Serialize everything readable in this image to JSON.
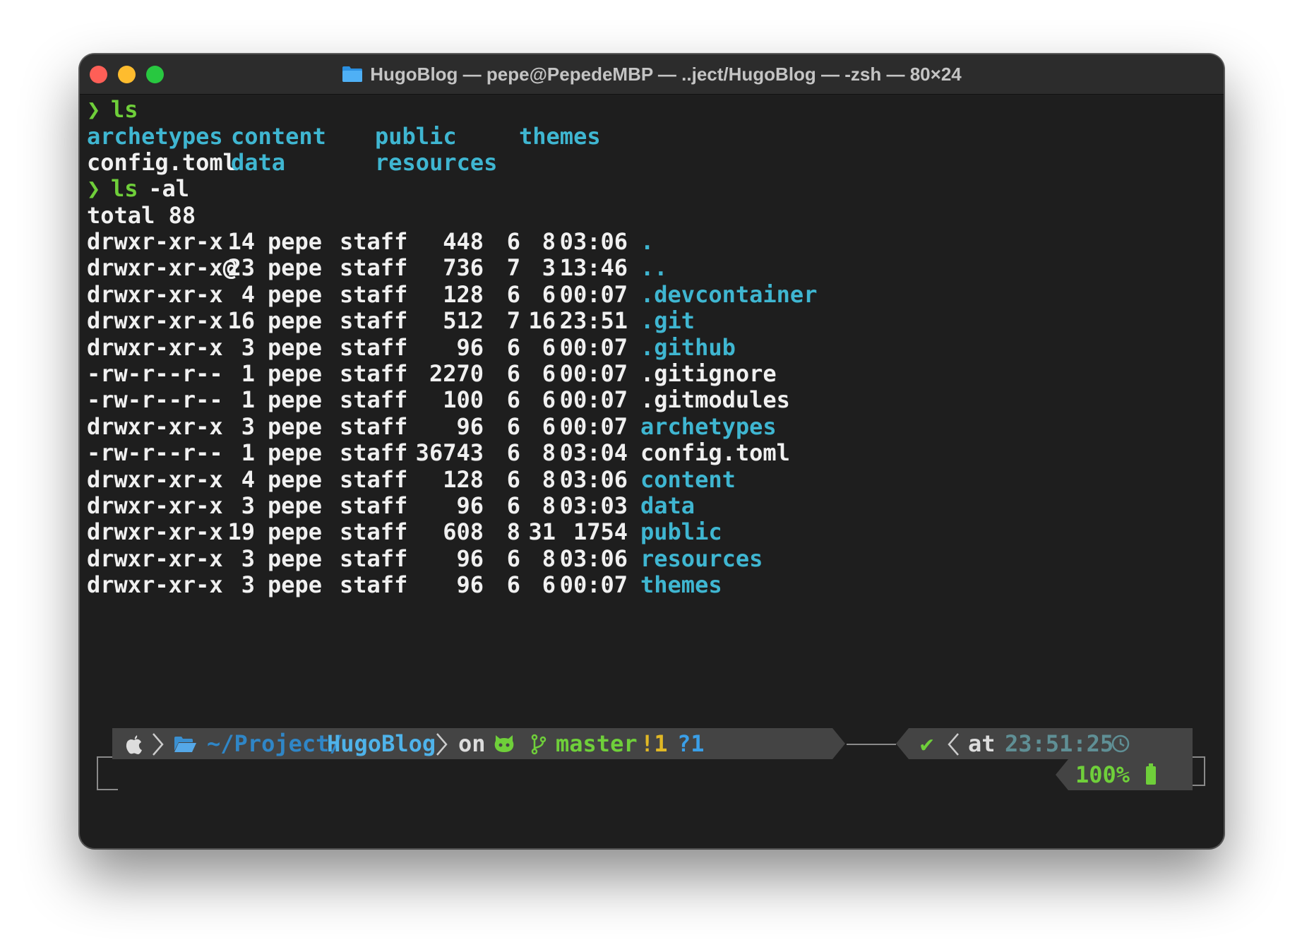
{
  "window": {
    "title": "HugoBlog — pepe@PepedeMBP — ..ject/HugoBlog — -zsh — 80×24",
    "icons": {
      "close": "close-traffic-light",
      "minimize": "minimize-traffic-light",
      "maximize": "maximize-traffic-light",
      "folder": "folder-icon"
    }
  },
  "colors": {
    "directory": "#3fb6d1",
    "prompt": "#6fcf3a",
    "text": "#f0f0f0",
    "background": "#1e1e1e"
  },
  "commands": [
    {
      "prompt": "❯",
      "cmd": "ls",
      "args": ""
    },
    {
      "prompt": "❯",
      "cmd": "ls",
      "args": " -al"
    }
  ],
  "ls_output": [
    [
      "archetypes",
      "content",
      "public",
      "themes"
    ],
    [
      "config.toml",
      "data",
      "resources",
      ""
    ]
  ],
  "total": "total 88",
  "listing": [
    {
      "perm": "drwxr-xr-x",
      "links": "14",
      "user": "pepe",
      "group": "staff",
      "size": "448",
      "month": "6",
      "day": "8",
      "time": "03:06",
      "name": ".",
      "dir": true
    },
    {
      "perm": "drwxr-xr-x@",
      "links": "23",
      "user": "pepe",
      "group": "staff",
      "size": "736",
      "month": "7",
      "day": "3",
      "time": "13:46",
      "name": "..",
      "dir": true
    },
    {
      "perm": "drwxr-xr-x",
      "links": "4",
      "user": "pepe",
      "group": "staff",
      "size": "128",
      "month": "6",
      "day": "6",
      "time": "00:07",
      "name": ".devcontainer",
      "dir": true
    },
    {
      "perm": "drwxr-xr-x",
      "links": "16",
      "user": "pepe",
      "group": "staff",
      "size": "512",
      "month": "7",
      "day": "16",
      "time": "23:51",
      "name": ".git",
      "dir": true
    },
    {
      "perm": "drwxr-xr-x",
      "links": "3",
      "user": "pepe",
      "group": "staff",
      "size": "96",
      "month": "6",
      "day": "6",
      "time": "00:07",
      "name": ".github",
      "dir": true
    },
    {
      "perm": "-rw-r--r--",
      "links": "1",
      "user": "pepe",
      "group": "staff",
      "size": "2270",
      "month": "6",
      "day": "6",
      "time": "00:07",
      "name": ".gitignore",
      "dir": false
    },
    {
      "perm": "-rw-r--r--",
      "links": "1",
      "user": "pepe",
      "group": "staff",
      "size": "100",
      "month": "6",
      "day": "6",
      "time": "00:07",
      "name": ".gitmodules",
      "dir": false
    },
    {
      "perm": "drwxr-xr-x",
      "links": "3",
      "user": "pepe",
      "group": "staff",
      "size": "96",
      "month": "6",
      "day": "6",
      "time": "00:07",
      "name": "archetypes",
      "dir": true
    },
    {
      "perm": "-rw-r--r--",
      "links": "1",
      "user": "pepe",
      "group": "staff",
      "size": "36743",
      "month": "6",
      "day": "8",
      "time": "03:04",
      "name": "config.toml",
      "dir": false
    },
    {
      "perm": "drwxr-xr-x",
      "links": "4",
      "user": "pepe",
      "group": "staff",
      "size": "128",
      "month": "6",
      "day": "8",
      "time": "03:06",
      "name": "content",
      "dir": true
    },
    {
      "perm": "drwxr-xr-x",
      "links": "3",
      "user": "pepe",
      "group": "staff",
      "size": "96",
      "month": "6",
      "day": "8",
      "time": "03:03",
      "name": "data",
      "dir": true
    },
    {
      "perm": "drwxr-xr-x",
      "links": "19",
      "user": "pepe",
      "group": "staff",
      "size": "608",
      "month": "8",
      "day": "31",
      "time": "1754",
      "name": "public",
      "dir": true
    },
    {
      "perm": "drwxr-xr-x",
      "links": "3",
      "user": "pepe",
      "group": "staff",
      "size": "96",
      "month": "6",
      "day": "8",
      "time": "03:06",
      "name": "resources",
      "dir": true
    },
    {
      "perm": "drwxr-xr-x",
      "links": "3",
      "user": "pepe",
      "group": "staff",
      "size": "96",
      "month": "6",
      "day": "6",
      "time": "00:07",
      "name": "themes",
      "dir": true
    }
  ],
  "prompt_bar": {
    "path_prefix": "~/Project/",
    "path_current": "HugoBlog",
    "on_label": "on",
    "branch": "master",
    "modified": "!1",
    "untracked": "?1",
    "status_ok": "✔",
    "at_label": "at",
    "clock": "23:51:25",
    "battery": "100%",
    "icons": {
      "os": "apple-icon",
      "folder": "folder-open-icon",
      "vcs": "github-icon",
      "branch": "git-branch-icon",
      "clock": "clock-icon",
      "battery": "battery-icon"
    }
  }
}
